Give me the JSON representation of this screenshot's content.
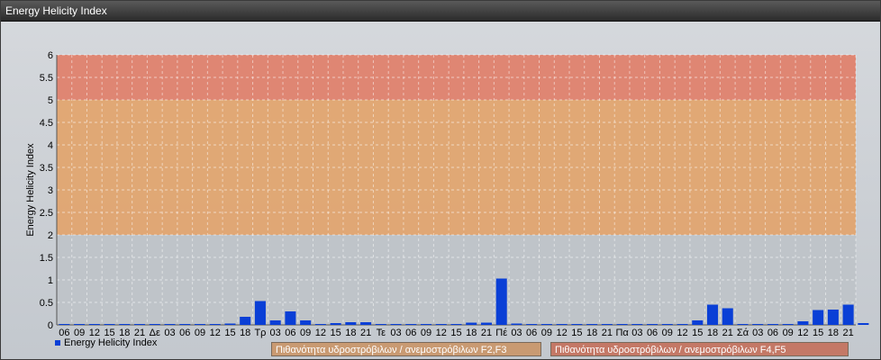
{
  "window": {
    "title": "Energy Helicity Index"
  },
  "legend": {
    "series_label": "Energy Helicity Index",
    "band1_label": "Πιθανότητα υδροστρόβιλων / ανεμοστρόβιλων F2,F3",
    "band2_label": "Πιθανότητα υδροστρόβιλων / ανεμοστρόβιλων F4,F5"
  },
  "colors": {
    "bar": "#0a3fd6",
    "band_low": "#c9b09a",
    "band_mid": "#e2a46c",
    "band_high": "#e07f6a",
    "band1_box": "#c99a72",
    "band2_box": "#c47866"
  },
  "chart_data": {
    "type": "bar",
    "title": "",
    "xlabel": "",
    "ylabel": "Energy Helicity Index",
    "ylim": [
      0,
      6
    ],
    "yticks": [
      "0",
      "0.5",
      "1",
      "1.5",
      "2",
      "2.5",
      "3",
      "3.5",
      "4",
      "4.5",
      "5",
      "5.5",
      "6"
    ],
    "grid": true,
    "legend_position": "bottom-left",
    "bands": [
      {
        "from": 2,
        "to": 5,
        "label": "Πιθανότητα υδροστρόβιλων / ανεμοστρόβιλων F2,F3"
      },
      {
        "from": 5,
        "to": 6,
        "label": "Πιθανότητα υδροστρόβιλων / ανεμοστρόβιλων F4,F5"
      }
    ],
    "categories": [
      "06",
      "09",
      "12",
      "15",
      "18",
      "21",
      "Δε",
      "03",
      "06",
      "09",
      "12",
      "15",
      "18",
      "Τρ",
      "03",
      "06",
      "09",
      "12",
      "15",
      "18",
      "21",
      "Τε",
      "03",
      "06",
      "09",
      "12",
      "15",
      "18",
      "21",
      "Πέ",
      "03",
      "06",
      "09",
      "12",
      "15",
      "18",
      "21",
      "Πα",
      "03",
      "06",
      "09",
      "12",
      "15",
      "18",
      "21",
      "Σά",
      "03",
      "06",
      "09",
      "12",
      "15",
      "18",
      "21"
    ],
    "series": [
      {
        "name": "Energy Helicity Index",
        "values": [
          0.02,
          0.02,
          0.02,
          0.02,
          0.02,
          0.02,
          0.02,
          0.02,
          0.02,
          0.02,
          0.02,
          0.03,
          0.18,
          0.53,
          0.1,
          0.3,
          0.1,
          0.02,
          0.04,
          0.06,
          0.06,
          0.02,
          0.02,
          0.02,
          0.02,
          0.02,
          0.02,
          0.05,
          0.05,
          1.03,
          0.03,
          0.02,
          0.02,
          0.02,
          0.02,
          0.02,
          0.02,
          0.02,
          0.02,
          0.02,
          0.02,
          0.02,
          0.1,
          0.45,
          0.37,
          0.02,
          0.02,
          0.02,
          0.02,
          0.08,
          0.33,
          0.34,
          0.45,
          0.04
        ]
      }
    ]
  }
}
